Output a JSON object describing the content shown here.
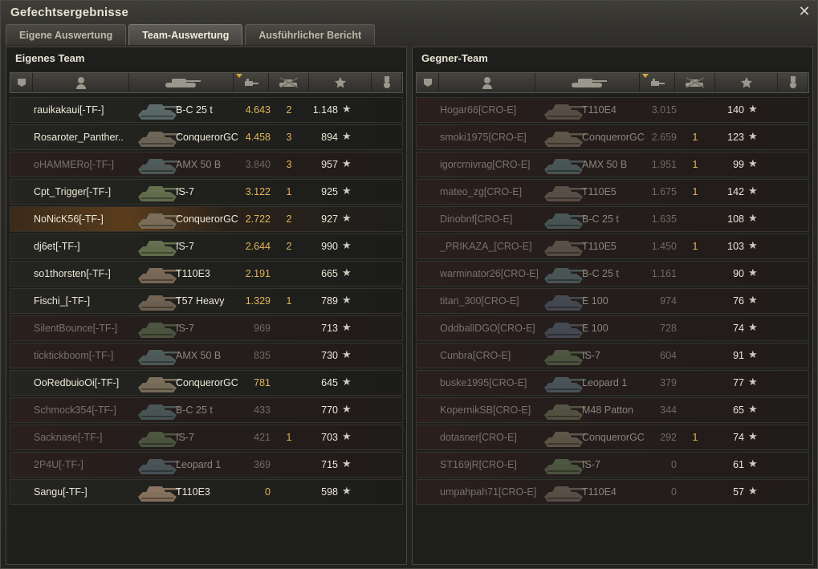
{
  "window": {
    "title": "Gefechtsergebnisse"
  },
  "tabs": [
    {
      "label": "Eigene Auswertung",
      "active": false
    },
    {
      "label": "Team-Auswertung",
      "active": true
    },
    {
      "label": "Ausführlicher Bericht",
      "active": false
    }
  ],
  "columns": [
    "platoon-icon",
    "player-icon",
    "tank-icon",
    "damage-icon",
    "kills-icon",
    "experience-star-icon",
    "medal-icon"
  ],
  "colors": {
    "accent": "#e2b45a",
    "self_row": "#5a3d1c",
    "dead_row": "#2a1f1d"
  },
  "own_team": {
    "title": "Eigenes Team",
    "players": [
      {
        "name": "rauikakaui[-TF-]",
        "tank": "B-C 25 t",
        "damage": "4.643",
        "kills": "2",
        "xp": "1.148",
        "alive": true,
        "self": false,
        "tank_color": "#5d6a6a"
      },
      {
        "name": "Rosaroter_Panther..",
        "tank": "ConquerorGC",
        "damage": "4.458",
        "kills": "3",
        "xp": "894",
        "alive": true,
        "self": false,
        "tank_color": "#6f6658"
      },
      {
        "name": "oHAMMERo[-TF-]",
        "tank": "AMX 50 B",
        "damage": "3.840",
        "kills": "3",
        "xp": "957",
        "alive": false,
        "self": false,
        "tank_color": "#4f5c5b"
      },
      {
        "name": "Cpt_Trigger[-TF-]",
        "tank": "IS-7",
        "damage": "3.122",
        "kills": "1",
        "xp": "925",
        "alive": true,
        "self": false,
        "tank_color": "#64704e"
      },
      {
        "name": "NoNicK56[-TF-]",
        "tank": "ConquerorGC",
        "damage": "2.722",
        "kills": "2",
        "xp": "927",
        "alive": true,
        "self": true,
        "tank_color": "#7a705c"
      },
      {
        "name": "dj6et[-TF-]",
        "tank": "IS-7",
        "damage": "2.644",
        "kills": "2",
        "xp": "990",
        "alive": true,
        "self": false,
        "tank_color": "#64704e"
      },
      {
        "name": "so1thorsten[-TF-]",
        "tank": "T110E3",
        "damage": "2.191",
        "kills": "",
        "xp": "665",
        "alive": true,
        "self": false,
        "tank_color": "#7b6a5a"
      },
      {
        "name": "Fischi_[-TF-]",
        "tank": "T57 Heavy",
        "damage": "1.329",
        "kills": "1",
        "xp": "789",
        "alive": true,
        "self": false,
        "tank_color": "#726352"
      },
      {
        "name": "SilentBounce[-TF-]",
        "tank": "IS-7",
        "damage": "969",
        "kills": "",
        "xp": "713",
        "alive": false,
        "self": false,
        "tank_color": "#4d5640"
      },
      {
        "name": "ticktickboom[-TF-]",
        "tank": "AMX 50 B",
        "damage": "835",
        "kills": "",
        "xp": "730",
        "alive": false,
        "self": false,
        "tank_color": "#4f5c5b"
      },
      {
        "name": "OoRedbuioOi[-TF-]",
        "tank": "ConquerorGC",
        "damage": "781",
        "kills": "",
        "xp": "645",
        "alive": true,
        "self": false,
        "tank_color": "#7a705c"
      },
      {
        "name": "Schmock354[-TF-]",
        "tank": "B-C 25 t",
        "damage": "433",
        "kills": "",
        "xp": "770",
        "alive": false,
        "self": false,
        "tank_color": "#4a5656"
      },
      {
        "name": "Sacknase[-TF-]",
        "tank": "IS-7",
        "damage": "421",
        "kills": "1",
        "xp": "703",
        "alive": false,
        "self": false,
        "tank_color": "#4d5640"
      },
      {
        "name": "2P4U[-TF-]",
        "tank": "Leopard 1",
        "damage": "369",
        "kills": "",
        "xp": "715",
        "alive": false,
        "self": false,
        "tank_color": "#4a5458"
      },
      {
        "name": "Sangu[-TF-]",
        "tank": "T110E3",
        "damage": "0",
        "kills": "",
        "xp": "598",
        "alive": true,
        "self": false,
        "tank_color": "#8a7360"
      }
    ]
  },
  "enemy_team": {
    "title": "Gegner-Team",
    "players": [
      {
        "name": "Hogar66[CRO-E]",
        "tank": "T110E4",
        "damage": "3.015",
        "kills": "",
        "xp": "140",
        "alive": false,
        "self": false,
        "tank_color": "#5a5048"
      },
      {
        "name": "smoki1975[CRO-E]",
        "tank": "ConquerorGC",
        "damage": "2.659",
        "kills": "1",
        "xp": "123",
        "alive": false,
        "self": false,
        "tank_color": "#5e5649"
      },
      {
        "name": "igorcrnivrag[CRO-E]",
        "tank": "AMX 50 B",
        "damage": "1.951",
        "kills": "1",
        "xp": "99",
        "alive": false,
        "self": false,
        "tank_color": "#4a5656"
      },
      {
        "name": "mateo_zg[CRO-E]",
        "tank": "T110E5",
        "damage": "1.675",
        "kills": "1",
        "xp": "142",
        "alive": false,
        "self": false,
        "tank_color": "#5a5048"
      },
      {
        "name": "Dinobnf[CRO-E]",
        "tank": "B-C 25 t",
        "damage": "1.635",
        "kills": "",
        "xp": "108",
        "alive": false,
        "self": false,
        "tank_color": "#4a5656"
      },
      {
        "name": "_PRIKAZA_[CRO-E]",
        "tank": "T110E5",
        "damage": "1.450",
        "kills": "1",
        "xp": "103",
        "alive": false,
        "self": false,
        "tank_color": "#5a5048"
      },
      {
        "name": "warminator26[CRO-E]",
        "tank": "B-C 25 t",
        "damage": "1.161",
        "kills": "",
        "xp": "90",
        "alive": false,
        "self": false,
        "tank_color": "#4a5656"
      },
      {
        "name": "titan_300[CRO-E]",
        "tank": "E 100",
        "damage": "974",
        "kills": "",
        "xp": "76",
        "alive": false,
        "self": false,
        "tank_color": "#454a52"
      },
      {
        "name": "OddballDGO[CRO-E]",
        "tank": "E 100",
        "damage": "728",
        "kills": "",
        "xp": "74",
        "alive": false,
        "self": false,
        "tank_color": "#454a52"
      },
      {
        "name": "Cunbra[CRO-E]",
        "tank": "IS-7",
        "damage": "604",
        "kills": "",
        "xp": "91",
        "alive": false,
        "self": false,
        "tank_color": "#4d5640"
      },
      {
        "name": "buske1995[CRO-E]",
        "tank": "Leopard 1",
        "damage": "379",
        "kills": "",
        "xp": "77",
        "alive": false,
        "self": false,
        "tank_color": "#4a5458"
      },
      {
        "name": "KopernikSB[CRO-E]",
        "tank": "M48 Patton",
        "damage": "344",
        "kills": "",
        "xp": "65",
        "alive": false,
        "self": false,
        "tank_color": "#535443"
      },
      {
        "name": "dotasner[CRO-E]",
        "tank": "ConquerorGC",
        "damage": "292",
        "kills": "1",
        "xp": "74",
        "alive": false,
        "self": false,
        "tank_color": "#5e5649"
      },
      {
        "name": "ST169jR[CRO-E]",
        "tank": "IS-7",
        "damage": "0",
        "kills": "",
        "xp": "61",
        "alive": false,
        "self": false,
        "tank_color": "#4d5640"
      },
      {
        "name": "umpahpah71[CRO-E]",
        "tank": "T110E4",
        "damage": "0",
        "kills": "",
        "xp": "57",
        "alive": false,
        "self": false,
        "tank_color": "#5a5048"
      }
    ]
  }
}
